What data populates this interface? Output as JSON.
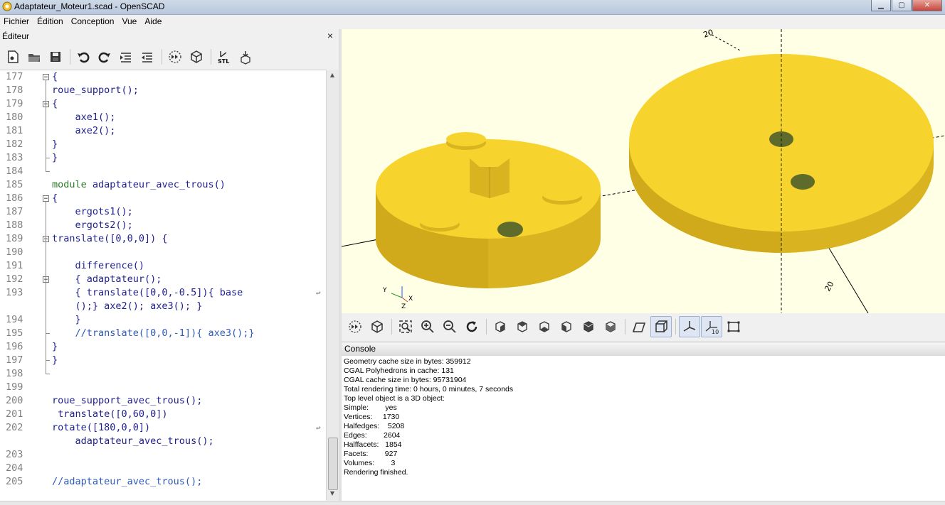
{
  "window": {
    "title": "Adaptateur_Moteur1.scad - OpenSCAD"
  },
  "menu": [
    "Fichier",
    "Édition",
    "Conception",
    "Vue",
    "Aide"
  ],
  "editor": {
    "title": "Éditeur",
    "close": "×",
    "toolbar": [
      "new-file-icon",
      "open-file-icon",
      "save-icon",
      "undo-icon",
      "redo-icon",
      "indent-icon",
      "unindent-icon",
      "preview-icon",
      "render-icon",
      "export-stl-icon",
      "send-to-print-icon"
    ],
    "lines": [
      {
        "n": "177",
        "t": "{",
        "fold": "minus"
      },
      {
        "n": "178",
        "t": "roue_support();"
      },
      {
        "n": "179",
        "t": "{",
        "fold": "minus"
      },
      {
        "n": "180",
        "t": "    axe1();"
      },
      {
        "n": "181",
        "t": "    axe2();"
      },
      {
        "n": "182",
        "t": "}"
      },
      {
        "n": "183",
        "t": "}"
      },
      {
        "n": "184",
        "t": ""
      },
      {
        "n": "185",
        "t": "module adaptateur_avec_trous()",
        "kw": "module"
      },
      {
        "n": "186",
        "t": "{",
        "fold": "minus"
      },
      {
        "n": "187",
        "t": "    ergots1();"
      },
      {
        "n": "188",
        "t": "    ergots2();"
      },
      {
        "n": "189",
        "t": "translate([0,0,0]) {",
        "fold": "minus"
      },
      {
        "n": "190",
        "t": ""
      },
      {
        "n": "191",
        "t": "    difference()"
      },
      {
        "n": "192",
        "t": "    { adaptateur();",
        "fold": "minus"
      },
      {
        "n": "193",
        "t": "    { translate([0,0,-0.5]){ base",
        "wrap": true
      },
      {
        "n": "",
        "t": "    ();} axe2(); axe3(); }"
      },
      {
        "n": "194",
        "t": "    }"
      },
      {
        "n": "195",
        "t": "    //translate([0,0,-1]){ axe3();}",
        "comment": true
      },
      {
        "n": "196",
        "t": "}"
      },
      {
        "n": "197",
        "t": "}"
      },
      {
        "n": "198",
        "t": ""
      },
      {
        "n": "199",
        "t": ""
      },
      {
        "n": "200",
        "t": "roue_support_avec_trous();"
      },
      {
        "n": "201",
        "t": " translate([0,60,0])"
      },
      {
        "n": "202",
        "t": "rotate([180,0,0])",
        "wrap": true
      },
      {
        "n": "",
        "t": "    adaptateur_avec_trous();"
      },
      {
        "n": "203",
        "t": ""
      },
      {
        "n": "204",
        "t": ""
      },
      {
        "n": "205",
        "t": "//adaptateur_avec_trous();",
        "comment": true
      }
    ]
  },
  "viewport": {
    "axis_labels": [
      "20",
      "20",
      "X",
      "Z",
      "Y"
    ],
    "colors": {
      "background": "#ffffe6",
      "part": "#f6d32d",
      "part_side": "#d9b420",
      "hole": "#6a7a3a"
    }
  },
  "view_toolbar": [
    "preview-icon",
    "render-icon",
    "zoom-all-icon",
    "zoom-in-icon",
    "zoom-out-icon",
    "reset-view-icon",
    "view-right-icon",
    "view-top-icon",
    "view-bottom-icon",
    "view-left-icon",
    "view-front-icon",
    "view-back-icon",
    "perspective-icon",
    "orthogonal-icon",
    "show-axes-icon",
    "show-scale-icon",
    "show-edges-icon"
  ],
  "console": {
    "title": "Console",
    "lines": [
      "Geometry cache size in bytes: 359912",
      "CGAL Polyhedrons in cache: 131",
      "CGAL cache size in bytes: 95731904",
      "Total rendering time: 0 hours, 0 minutes, 7 seconds",
      "Top level object is a 3D object:",
      "Simple:        yes",
      "Vertices:     1730",
      "Halfedges:    5208",
      "Edges:        2604",
      "Halffacets:   1854",
      "Facets:        927",
      "Volumes:        3",
      "Rendering finished."
    ]
  }
}
